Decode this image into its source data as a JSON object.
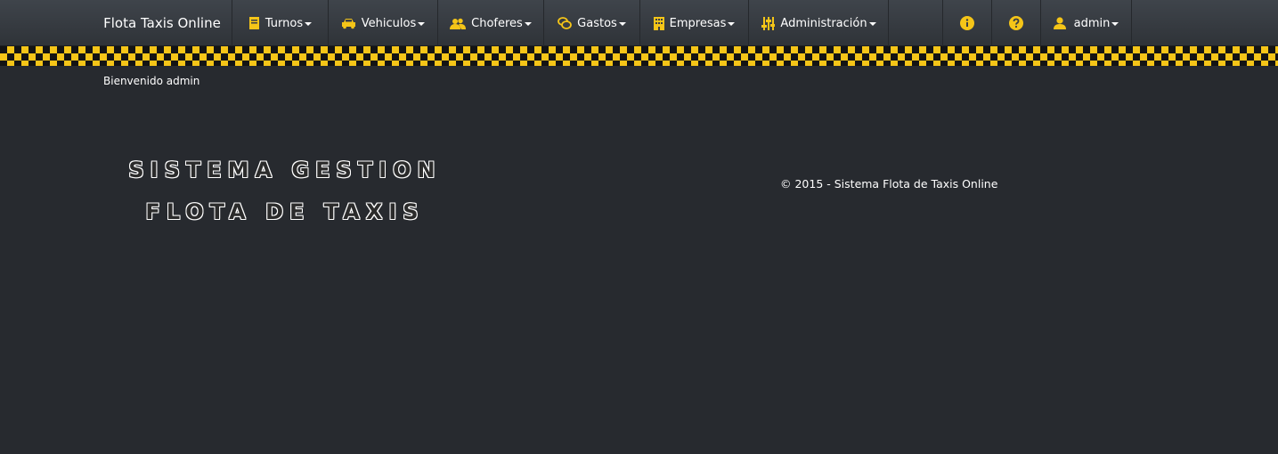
{
  "navbar": {
    "brand": "Flota Taxis Online",
    "items": [
      {
        "label": "Turnos",
        "icon": "book-icon"
      },
      {
        "label": "Vehiculos",
        "icon": "car-icon"
      },
      {
        "label": "Choferes",
        "icon": "users-icon"
      },
      {
        "label": "Gastos",
        "icon": "coins-icon"
      },
      {
        "label": "Empresas",
        "icon": "building-icon"
      },
      {
        "label": "Administración",
        "icon": "sliders-icon"
      }
    ],
    "right": {
      "info_icon": "info-icon",
      "help_icon": "help-icon",
      "user_label": "admin",
      "user_icon": "user-icon"
    }
  },
  "colors": {
    "accent": "#f5c518",
    "background": "#272a2f",
    "navbar": "#3a3e44"
  },
  "welcome": "Bienvenido admin",
  "hero": {
    "line1": "SISTEMA GESTION",
    "line2": "FLOTA DE TAXIS"
  },
  "footer": "© 2015 - Sistema Flota de Taxis Online"
}
